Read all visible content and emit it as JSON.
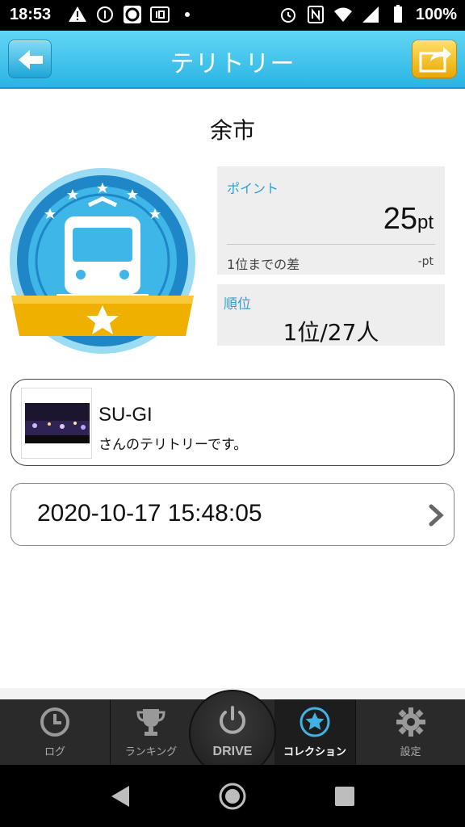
{
  "status_bar": {
    "time": "18:53",
    "battery": "100%"
  },
  "header": {
    "title": "テリトリー"
  },
  "territory": {
    "name": "余市"
  },
  "points": {
    "label": "ポイント",
    "value": "25",
    "unit": "pt",
    "diff_label": "1位までの差",
    "diff_value": "-pt"
  },
  "rank": {
    "label": "順位",
    "value": "1位/27人"
  },
  "owner": {
    "name": "SU-GI",
    "subtitle": "さんのテリトリーです。"
  },
  "timestamp": "2020-10-17 15:48:05",
  "tabs": {
    "log": "ログ",
    "ranking": "ランキング",
    "drive": "DRIVE",
    "collection": "コレクション",
    "settings": "設定"
  },
  "colors": {
    "accent": "#2ab4e3",
    "label_blue": "#2ba1d3",
    "ribbon": "#f0b000"
  }
}
